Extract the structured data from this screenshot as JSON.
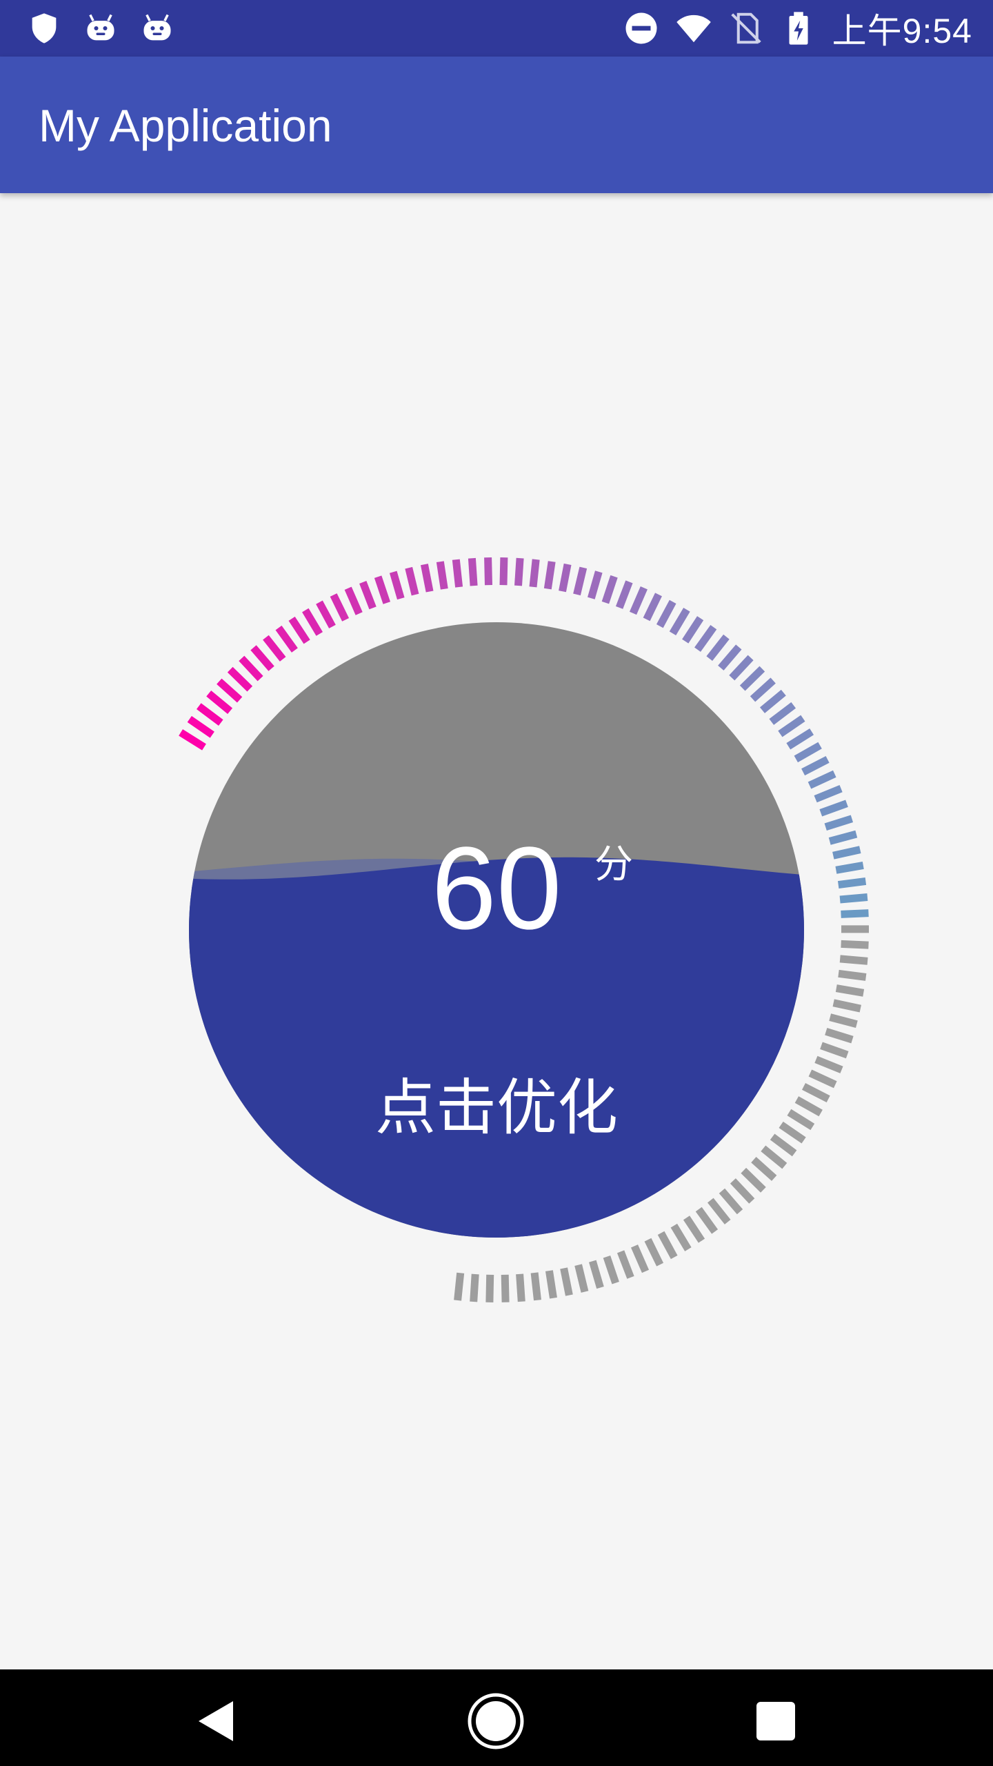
{
  "status_bar": {
    "time": "上午9:54",
    "left_icons": [
      "shield-icon",
      "android-debug-icon",
      "android-debug-icon"
    ],
    "right_icons": [
      "do-not-disturb-icon",
      "wifi-icon",
      "no-sim-icon",
      "battery-charging-icon"
    ]
  },
  "app_bar": {
    "title": "My Application"
  },
  "gauge": {
    "score": "60",
    "unit": "分",
    "action_label": "点击优化",
    "fill_level": 0.6,
    "colors": {
      "tick_start": "#ff00aa",
      "tick_mid": "#8a7fbf",
      "tick_end": "#6a9ac4",
      "tick_inactive": "#9e9e9e",
      "water": "#303c9a",
      "empty": "#868686"
    }
  },
  "nav_bar": {
    "buttons": [
      "back-icon",
      "home-icon",
      "recents-icon"
    ]
  }
}
